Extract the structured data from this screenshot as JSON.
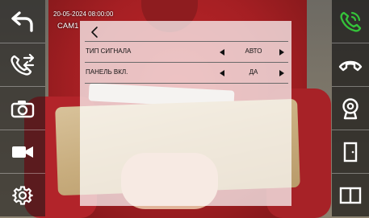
{
  "overlay": {
    "datetime": "20-05-2024 08:00:00",
    "camera": "CAM1"
  },
  "menu": {
    "rows": [
      {
        "label": "ТИП СИГНАЛА",
        "value": "АВТО"
      },
      {
        "label": "ПАНЕЛЬ ВКЛ.",
        "value": "ДА"
      }
    ]
  },
  "left_buttons": [
    "back-icon",
    "call-transfer-icon",
    "camera-icon",
    "video-record-icon",
    "gear-icon"
  ],
  "right_buttons": [
    "answer-call-icon",
    "hang-up-icon",
    "webcam-icon",
    "door-icon",
    "split-screen-icon"
  ],
  "colors": {
    "answer": "#35c23a",
    "icon": "#ffffff",
    "panel": "#ffffff"
  }
}
